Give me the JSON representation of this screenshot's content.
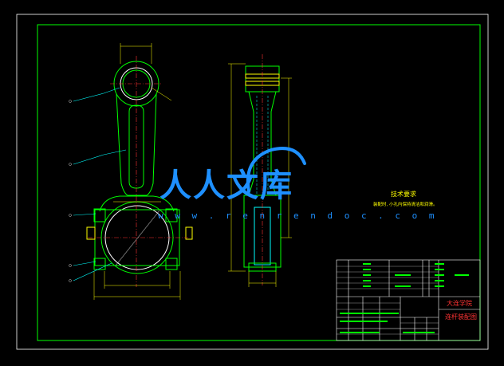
{
  "watermark": {
    "text": "人人文库",
    "url": "w w w . r e n r e n d o c . c o m",
    "color": "#1e90ff"
  },
  "technical_requirements": {
    "title": "技术要求",
    "note": "装配时, 小孔内保持清洁和润滑。"
  },
  "title_block": {
    "school": "大连学院",
    "drawing_name": "连杆装配图"
  },
  "colors": {
    "frame": "#00ff00",
    "outline": "#00ff00",
    "dimension": "#ffff00",
    "centerline": "#ff3333",
    "hidden": "#00ffff",
    "leader": "#00ffff",
    "highlight": "#ffffff"
  }
}
